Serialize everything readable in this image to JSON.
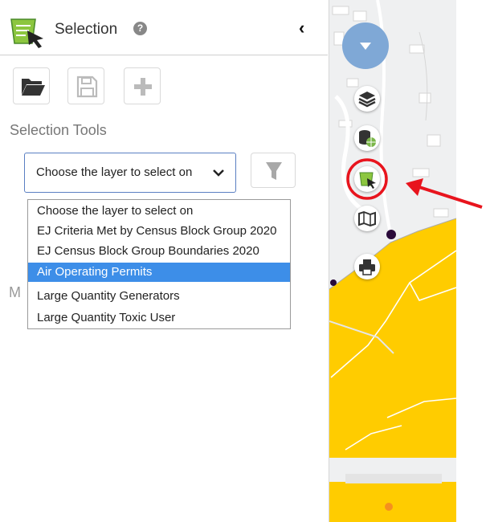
{
  "panel": {
    "title": "Selection",
    "help_glyph": "?",
    "collapse_glyph": "‹",
    "toolbar": [
      "folder-open-icon",
      "save-icon",
      "plus-icon"
    ],
    "section_label": "Selection Tools",
    "select_value": "Choose the layer to select on",
    "partial_label": "M"
  },
  "dropdown": {
    "options": [
      "Choose the layer to select on",
      "EJ Criteria Met by Census Block Group 2020",
      "EJ Census Block Group Boundaries 2020",
      "Air Operating Permits",
      "Large Quantity Generators",
      "Large Quantity Toxic User"
    ],
    "highlighted_index": 3
  },
  "map_tools": [
    "layers-icon",
    "database-globe-icon",
    "selection-icon",
    "map-icon",
    "print-icon"
  ],
  "colors": {
    "highlight": "#3d8ee8",
    "map_fill": "#ffcc00",
    "annotation_red": "#e8141d",
    "main_button": "#7fa8d6",
    "select_border": "#5a7fc2"
  }
}
